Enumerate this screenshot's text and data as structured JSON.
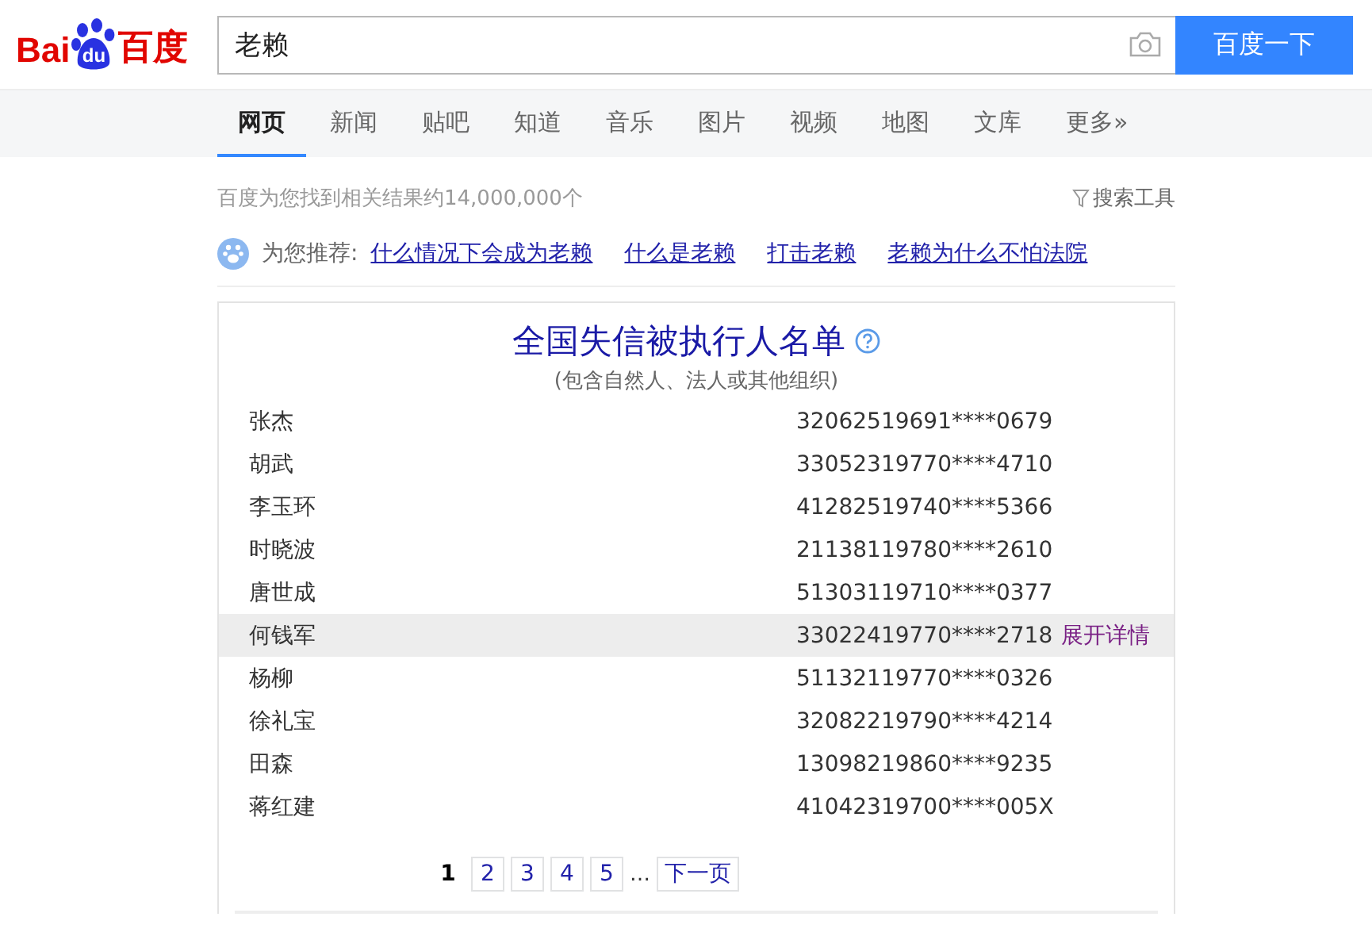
{
  "logo": {
    "left": "Bai",
    "paw": "du",
    "right": "百度"
  },
  "search": {
    "value": "老赖",
    "button": "百度一下"
  },
  "tabs": [
    {
      "label": "网页",
      "selected": true
    },
    {
      "label": "新闻",
      "selected": false
    },
    {
      "label": "贴吧",
      "selected": false
    },
    {
      "label": "知道",
      "selected": false
    },
    {
      "label": "音乐",
      "selected": false
    },
    {
      "label": "图片",
      "selected": false
    },
    {
      "label": "视频",
      "selected": false
    },
    {
      "label": "地图",
      "selected": false
    },
    {
      "label": "文库",
      "selected": false
    },
    {
      "label": "更多»",
      "selected": false
    }
  ],
  "result_count": "百度为您找到相关结果约14,000,000个",
  "search_tools": "搜索工具",
  "recommend": {
    "label": "为您推荐:",
    "links": [
      "什么情况下会成为老赖",
      "什么是老赖",
      "打击老赖",
      "老赖为什么不怕法院"
    ]
  },
  "card": {
    "title": "全国失信被执行人名单",
    "subtitle": "(包含自然人、法人或其他组织)",
    "rows": [
      {
        "name": "张杰",
        "id": "32062519691****0679",
        "highlighted": false
      },
      {
        "name": "胡武",
        "id": "33052319770****4710",
        "highlighted": false
      },
      {
        "name": "李玉环",
        "id": "41282519740****5366",
        "highlighted": false
      },
      {
        "name": "时晓波",
        "id": "21138119780****2610",
        "highlighted": false
      },
      {
        "name": "唐世成",
        "id": "51303119710****0377",
        "highlighted": false
      },
      {
        "name": "何钱军",
        "id": "33022419770****2718",
        "highlighted": true,
        "action": "展开详情"
      },
      {
        "name": "杨柳",
        "id": "51132119770****0326",
        "highlighted": false
      },
      {
        "name": "徐礼宝",
        "id": "32082219790****4214",
        "highlighted": false
      },
      {
        "name": "田森",
        "id": "13098219860****9235",
        "highlighted": false
      },
      {
        "name": "蒋红建",
        "id": "41042319700****005X",
        "highlighted": false
      }
    ],
    "pages": [
      {
        "label": "1",
        "selected": true
      },
      {
        "label": "2",
        "selected": false
      },
      {
        "label": "3",
        "selected": false
      },
      {
        "label": "4",
        "selected": false
      },
      {
        "label": "5",
        "selected": false
      }
    ],
    "ellipsis": "…",
    "next": "下一页"
  }
}
